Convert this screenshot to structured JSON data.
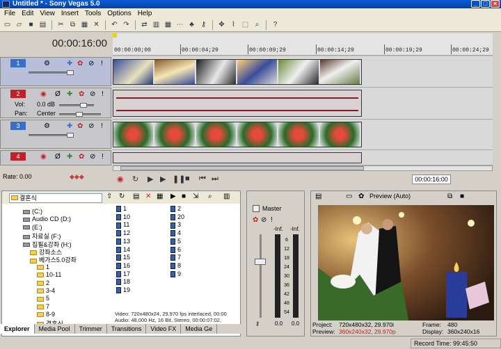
{
  "window": {
    "title": "Untitled * - Sony Vegas 5.0"
  },
  "menu": [
    "File",
    "Edit",
    "View",
    "Insert",
    "Tools",
    "Options",
    "Help"
  ],
  "timeline": {
    "timecode": "00:00:16:00",
    "ruler": [
      "00:00:00;00",
      "00:00:04;29",
      "00:00:09;29",
      "00:00:14;29",
      "00:00:19;29",
      "00:00:24;29"
    ],
    "rate": "Rate: 0.00",
    "end_timecode": "00:00:16:00"
  },
  "tracks": [
    {
      "number": "1",
      "type": "video"
    },
    {
      "number": "2",
      "type": "audio",
      "vol_label": "Vol:",
      "vol_value": "0.0 dB",
      "pan_label": "Pan:",
      "pan_value": "Center"
    },
    {
      "number": "3",
      "type": "video"
    },
    {
      "number": "4",
      "type": "audio"
    }
  ],
  "explorer": {
    "path": "결혼식",
    "tree": [
      {
        "label": "(C:)",
        "kind": "drive",
        "indent": 0
      },
      {
        "label": "Audio CD (D:)",
        "kind": "drive",
        "indent": 0
      },
      {
        "label": "(E:)",
        "kind": "drive",
        "indent": 0
      },
      {
        "label": "자료실 (F:)",
        "kind": "drive",
        "indent": 0
      },
      {
        "label": "집필&강좌 (H:)",
        "kind": "drive",
        "indent": 0
      },
      {
        "label": "강좌소스",
        "kind": "folder",
        "indent": 1
      },
      {
        "label": "베가스5.0강좌",
        "kind": "folder",
        "indent": 1
      },
      {
        "label": "1",
        "kind": "folder",
        "indent": 2
      },
      {
        "label": "10-11",
        "kind": "folder",
        "indent": 2
      },
      {
        "label": "2",
        "kind": "folder",
        "indent": 2
      },
      {
        "label": "3-4",
        "kind": "folder",
        "indent": 2
      },
      {
        "label": "5",
        "kind": "folder",
        "indent": 2
      },
      {
        "label": "7",
        "kind": "folder",
        "indent": 2
      },
      {
        "label": "8-9",
        "kind": "folder",
        "indent": 2
      },
      {
        "label": "결혼식",
        "kind": "folder",
        "indent": 2
      }
    ],
    "files_col1": [
      "1",
      "10",
      "11",
      "12",
      "13",
      "14",
      "15",
      "16",
      "17",
      "18",
      "19"
    ],
    "files_col2": [
      "2",
      "20",
      "3",
      "4",
      "5",
      "6",
      "7",
      "8",
      "9"
    ],
    "info_line1": "Video: 720x480x24, 29.970 fps interlaced, 00:00",
    "info_line2": "Audio: 48,000 Hz, 16 Bit, Stereo, 00:00:07:02,",
    "tabs": [
      "Explorer",
      "Media Pool",
      "Trimmer",
      "Transitions",
      "Video FX",
      "Media Ge"
    ]
  },
  "mixer": {
    "label": "Master",
    "inf_left": "-Inf.",
    "inf_right": "-Inf.",
    "scale": [
      "6",
      "12",
      "18",
      "24",
      "30",
      "36",
      "42",
      "48",
      "54"
    ],
    "val_left": "0.0",
    "val_right": "0.0"
  },
  "preview": {
    "mode": "Preview (Auto)",
    "project_label": "Project:",
    "project_value": "720x480x32, 29.970i",
    "preview_label": "Preview:",
    "preview_value": "360x240x32, 29.970p",
    "frame_label": "Frame:",
    "frame_value": "480",
    "display_label": "Display:",
    "display_value": "360x240x16"
  },
  "status": {
    "record_time": "Record Time: 99:45:50"
  },
  "colors": {
    "title_bar": "#0a5bd8",
    "track_red": "#c0202a",
    "track_blue": "#3a6fc8",
    "waveform": "#8a1a2a"
  }
}
